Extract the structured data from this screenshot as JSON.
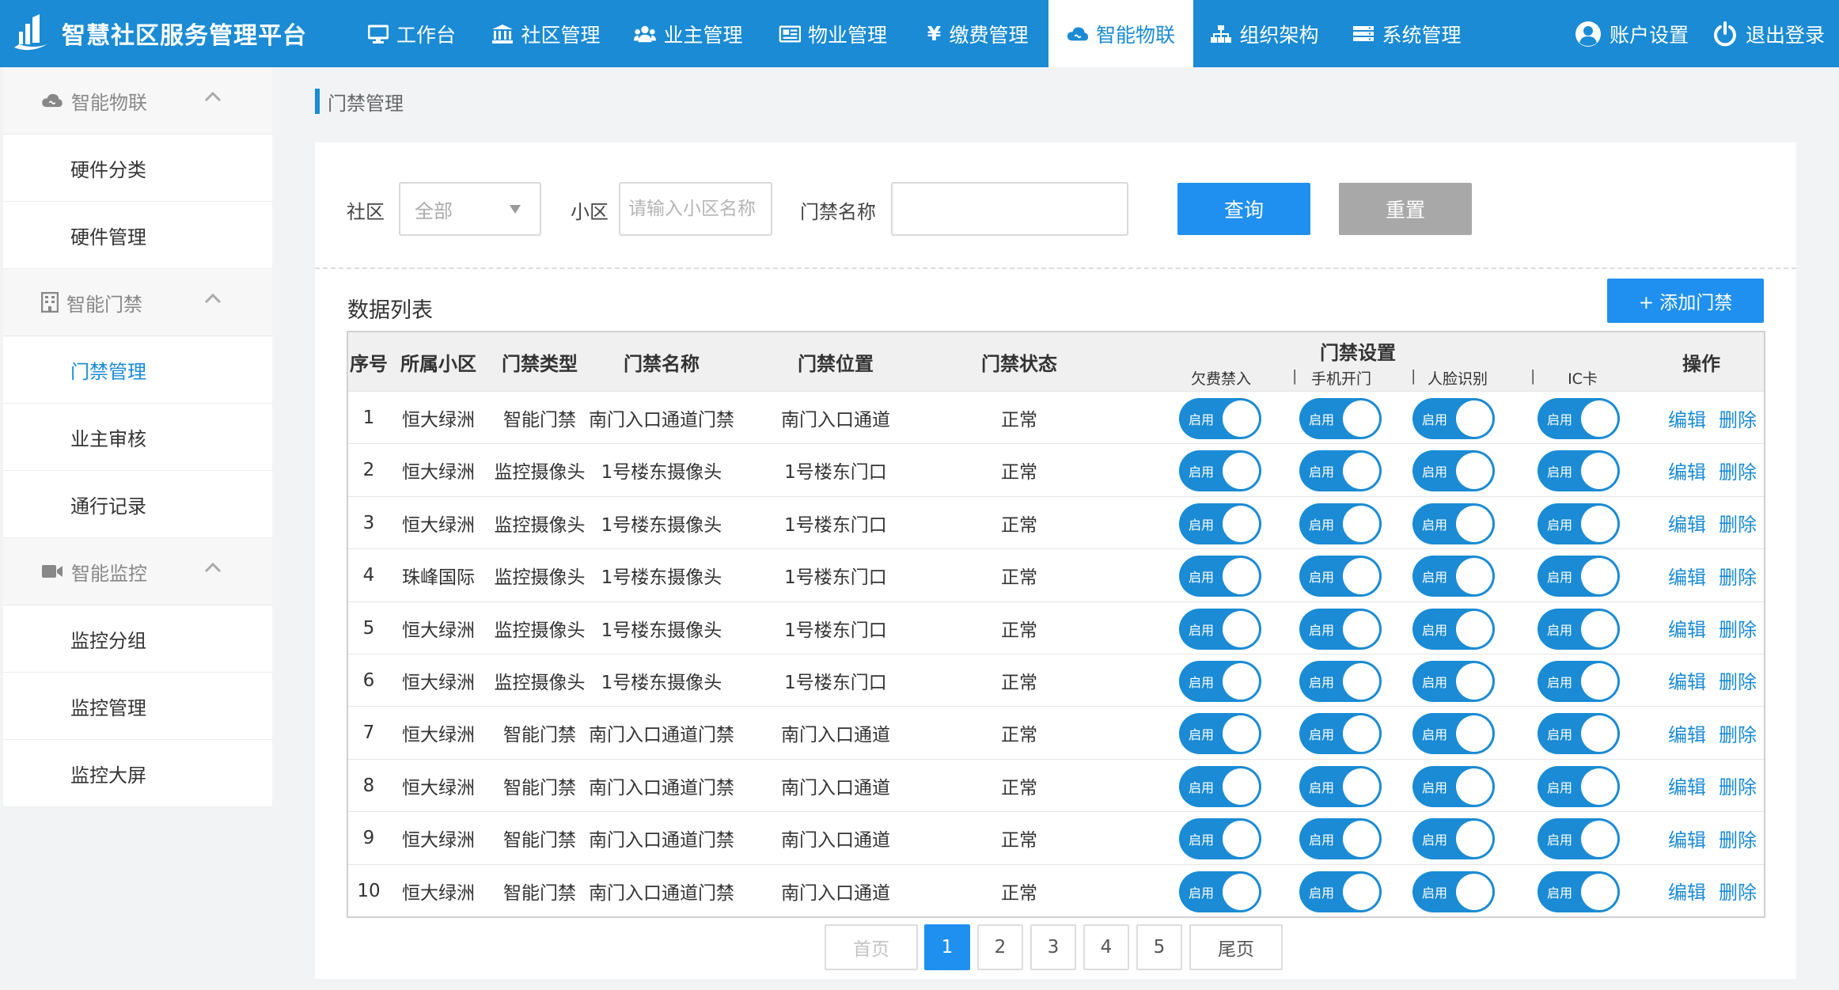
{
  "app": {
    "title": "智慧社区服务管理平台"
  },
  "nav": {
    "items": [
      {
        "label": "工作台",
        "icon": "monitor-icon"
      },
      {
        "label": "社区管理",
        "icon": "bank-icon"
      },
      {
        "label": "业主管理",
        "icon": "users-icon"
      },
      {
        "label": "物业管理",
        "icon": "newspaper-icon"
      },
      {
        "label": "缴费管理",
        "icon": "yen-icon"
      },
      {
        "label": "智能物联",
        "icon": "cloud-icon",
        "active": true
      },
      {
        "label": "组织架构",
        "icon": "sitemap-icon"
      },
      {
        "label": "系统管理",
        "icon": "server-icon"
      }
    ],
    "account": "账户设置",
    "logout": "退出登录"
  },
  "sidebar": {
    "groups": [
      {
        "label": "智能物联",
        "icon": "cloud-icon",
        "items": [
          "硬件分类",
          "硬件管理"
        ]
      },
      {
        "label": "智能门禁",
        "icon": "building-icon",
        "items": [
          "门禁管理",
          "业主审核",
          "通行记录"
        ]
      },
      {
        "label": "智能监控",
        "icon": "video-camera-icon",
        "items": [
          "监控分组",
          "监控管理",
          "监控大屏"
        ]
      }
    ],
    "active_item": "门禁管理"
  },
  "breadcrumb": {
    "current": "门禁管理"
  },
  "filter": {
    "community_label": "社区",
    "community_value": "全部",
    "estate_label": "小区",
    "estate_placeholder": "请输入小区名称",
    "gate_name_label": "门禁名称",
    "gate_name_value": "",
    "query_label": "查询",
    "reset_label": "重置"
  },
  "list": {
    "title": "数据列表",
    "add_label": "+ 添加门禁"
  },
  "table": {
    "headers": {
      "index": "序号",
      "estate": "所属小区",
      "type": "门禁类型",
      "name": "门禁名称",
      "location": "门禁位置",
      "status": "门禁状态",
      "settings": "门禁设置",
      "actions": "操作"
    },
    "sub_headers": [
      "欠费禁入",
      "手机开门",
      "人脸识别",
      "IC卡"
    ],
    "separator": "|",
    "toggle_label": "启用",
    "edit_label": "编辑",
    "delete_label": "删除",
    "rows": [
      {
        "index": "1",
        "estate": "恒大绿洲",
        "type": "智能门禁",
        "name": "南门入口通道门禁",
        "location": "南门入口通道",
        "status": "正常"
      },
      {
        "index": "2",
        "estate": "恒大绿洲",
        "type": "监控摄像头",
        "name": "1号楼东摄像头",
        "location": "1号楼东门口",
        "status": "正常"
      },
      {
        "index": "3",
        "estate": "恒大绿洲",
        "type": "监控摄像头",
        "name": "1号楼东摄像头",
        "location": "1号楼东门口",
        "status": "正常"
      },
      {
        "index": "4",
        "estate": "珠峰国际",
        "type": "监控摄像头",
        "name": "1号楼东摄像头",
        "location": "1号楼东门口",
        "status": "正常"
      },
      {
        "index": "5",
        "estate": "恒大绿洲",
        "type": "监控摄像头",
        "name": "1号楼东摄像头",
        "location": "1号楼东门口",
        "status": "正常"
      },
      {
        "index": "6",
        "estate": "恒大绿洲",
        "type": "监控摄像头",
        "name": "1号楼东摄像头",
        "location": "1号楼东门口",
        "status": "正常"
      },
      {
        "index": "7",
        "estate": "恒大绿洲",
        "type": "智能门禁",
        "name": "南门入口通道门禁",
        "location": "南门入口通道",
        "status": "正常"
      },
      {
        "index": "8",
        "estate": "恒大绿洲",
        "type": "智能门禁",
        "name": "南门入口通道门禁",
        "location": "南门入口通道",
        "status": "正常"
      },
      {
        "index": "9",
        "estate": "恒大绿洲",
        "type": "智能门禁",
        "name": "南门入口通道门禁",
        "location": "南门入口通道",
        "status": "正常"
      },
      {
        "index": "10",
        "estate": "恒大绿洲",
        "type": "智能门禁",
        "name": "南门入口通道门禁",
        "location": "南门入口通道",
        "status": "正常"
      }
    ]
  },
  "pagination": {
    "first": "首页",
    "pages": [
      "1",
      "2",
      "3",
      "4",
      "5"
    ],
    "current": "1",
    "last": "尾页"
  },
  "colors": {
    "primary": "#1a8bd4",
    "button_blue": "#1f90f0",
    "reset_gray": "#a8a8a8"
  }
}
